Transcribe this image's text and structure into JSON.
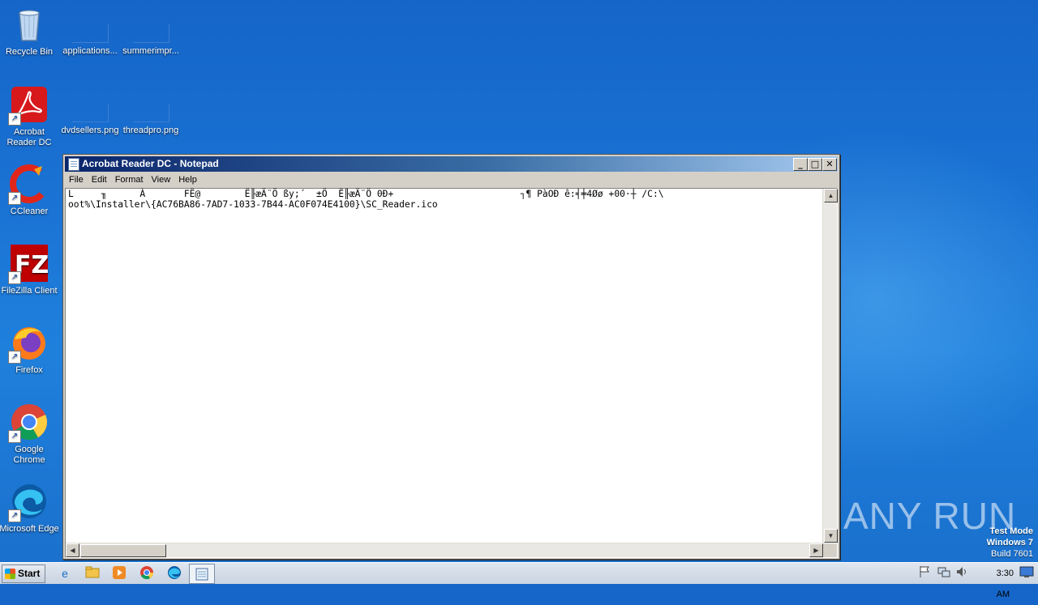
{
  "desktop": {
    "icons": [
      {
        "label": "Recycle Bin"
      },
      {
        "label": "applications..."
      },
      {
        "label": "summerimpr..."
      },
      {
        "label": "Acrobat Reader DC"
      },
      {
        "label": "dvdsellers.png"
      },
      {
        "label": "threadpro.png"
      },
      {
        "label": "CCleaner"
      },
      {
        "label": "FileZilla Client"
      },
      {
        "label": "Firefox"
      },
      {
        "label": "Google Chrome"
      },
      {
        "label": "Microsoft Edge"
      }
    ]
  },
  "window": {
    "title": "Acrobat Reader DC - Notepad",
    "menu": [
      "File",
      "Edit",
      "Format",
      "View",
      "Help"
    ],
    "content_line1": "L     ╖      À       FË@        Ë╟æÄ¨Ö ßy;´  ±Ö  Ë╟æÄ¨Ö 0Ð+                       ┐¶ PàOÐ ê:╡╪4Øø +00·┼ /C:\\",
    "content_line2": "oot%\\Installer\\{AC76BA86-7AD7-1033-7B44-AC0F074E4100}\\SC_Reader.ico"
  },
  "watermark": "ANY RUN",
  "testmode": {
    "line1": "Test Mode",
    "line2": "Windows 7",
    "line3": "Build 7601"
  },
  "taskbar": {
    "start_label": "Start",
    "clock": "3:30 AM"
  }
}
